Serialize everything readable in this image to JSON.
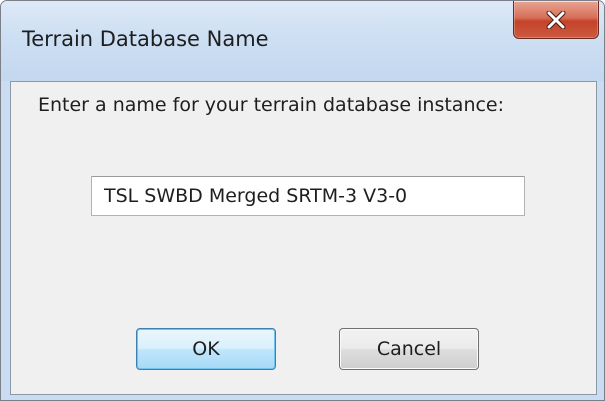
{
  "dialog": {
    "title": "Terrain Database Name",
    "prompt": "Enter a name for your terrain database instance:",
    "name_value": "TSL SWBD Merged SRTM-3 V3-0",
    "ok_label": "OK",
    "cancel_label": "Cancel",
    "close_icon": "close-x-icon"
  },
  "colors": {
    "close_button": "#c4432a",
    "ok_border": "#3c7fb1",
    "window_frame": "#c9dcf1"
  }
}
